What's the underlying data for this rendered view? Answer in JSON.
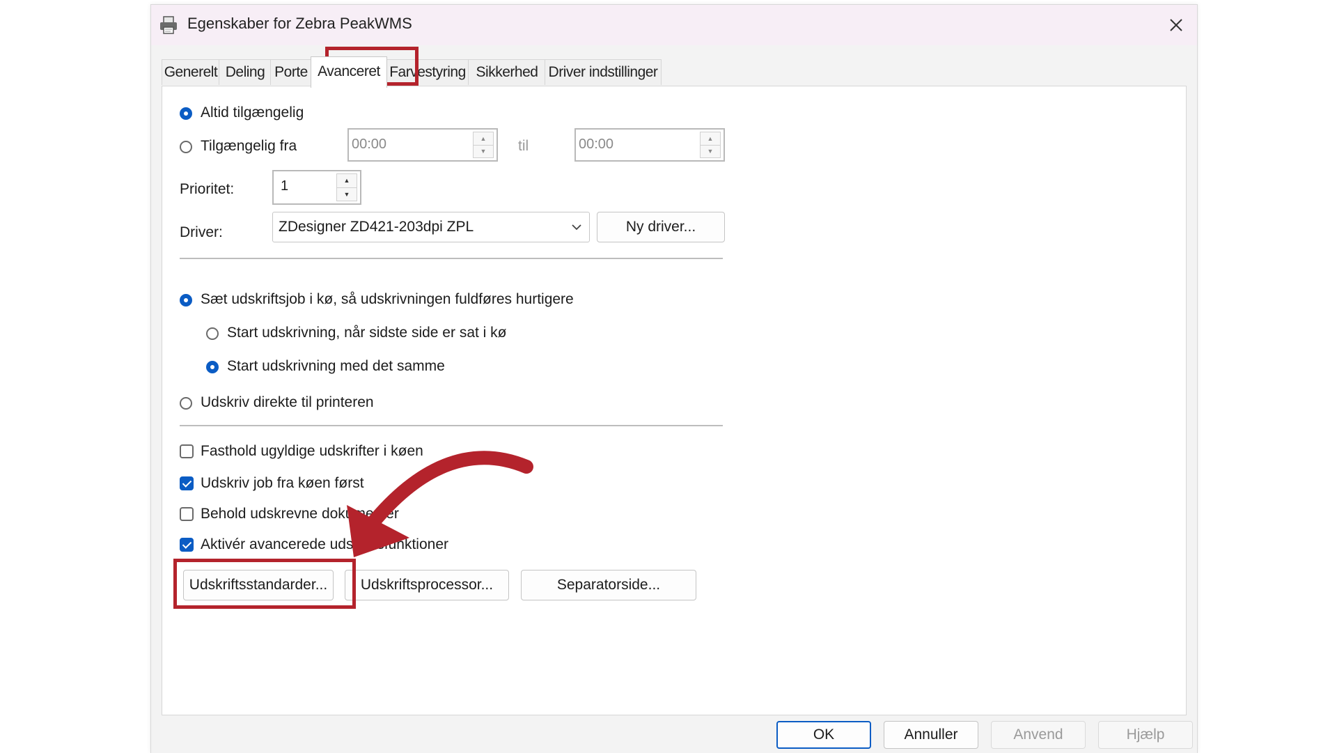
{
  "window": {
    "title": "Egenskaber for Zebra PeakWMS",
    "icon": "printer-icon",
    "close_icon": "close-icon"
  },
  "tabs": [
    {
      "label": "Generelt"
    },
    {
      "label": "Deling"
    },
    {
      "label": "Porte"
    },
    {
      "label": "Avanceret",
      "active": true
    },
    {
      "label": "Farvestyring"
    },
    {
      "label": "Sikkerhed"
    },
    {
      "label": "Driver indstillinger"
    }
  ],
  "availability": {
    "always_label": "Altid tilgængelig",
    "from_label": "Tilgængelig fra",
    "from_time": "00:00",
    "to_label": "til",
    "to_time": "00:00",
    "selected": "always"
  },
  "priority": {
    "label": "Prioritet:",
    "value": "1"
  },
  "driver": {
    "label": "Driver:",
    "value": "ZDesigner ZD421-203dpi ZPL",
    "new_driver_label": "Ny driver..."
  },
  "spooling": {
    "spool_label": "Sæt udskriftsjob i kø, så udskrivningen fuldføres hurtigere",
    "after_last_page_label": "Start udskrivning, når sidste side er sat i kø",
    "immediately_label": "Start udskrivning med det samme",
    "direct_label": "Udskriv direkte til printeren"
  },
  "options": [
    {
      "label": "Fasthold ugyldige udskrifter i køen",
      "checked": false
    },
    {
      "label": "Udskriv job fra køen først",
      "checked": true
    },
    {
      "label": "Behold udskrevne dokumenter",
      "checked": false
    },
    {
      "label": "Aktivér avancerede udskriftsfunktioner",
      "checked": true
    }
  ],
  "buttons": {
    "defaults": "Udskriftsstandarder...",
    "processor": "Udskriftsprocessor...",
    "separator": "Separatorside..."
  },
  "footer": {
    "ok": "OK",
    "cancel": "Annuller",
    "apply": "Anvend",
    "help": "Hjælp"
  },
  "colors": {
    "accent": "#0b5cc4",
    "highlight": "#b4232c",
    "titlebar": "#f7eef6"
  }
}
